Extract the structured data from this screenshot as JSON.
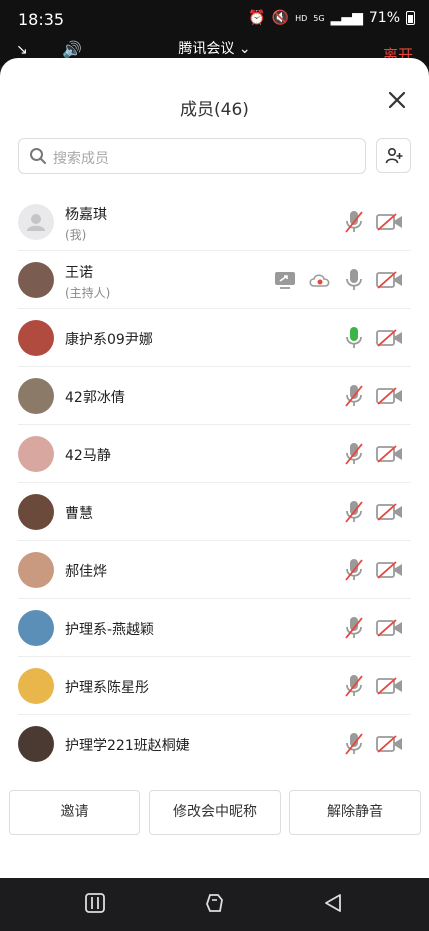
{
  "status_bar": {
    "time": "18:35",
    "net_hd": "HD",
    "net_5g": "5G",
    "battery": "71%"
  },
  "meeting_bar": {
    "title": "腾讯会议",
    "leave": "离开"
  },
  "panel": {
    "title": "成员(46)",
    "search_placeholder": "搜索成员"
  },
  "members": [
    {
      "name": "杨嘉琪",
      "sub": "(我)",
      "mic": "muted",
      "cam": "off",
      "avatar": "default"
    },
    {
      "name": "王诺",
      "sub": "(主持人)",
      "mic": "on-gray",
      "cam": "off",
      "sharing": true,
      "recording": true,
      "avatar_color": "#7a5d50"
    },
    {
      "name": "康护系09尹娜",
      "mic": "active",
      "cam": "off",
      "avatar_color": "#b24b3f"
    },
    {
      "name": "42郭冰倩",
      "mic": "muted",
      "cam": "off",
      "avatar_color": "#8c7a68"
    },
    {
      "name": "42马静",
      "mic": "muted",
      "cam": "off",
      "avatar_color": "#d8a7a0"
    },
    {
      "name": "曹慧",
      "mic": "muted",
      "cam": "off",
      "avatar_color": "#6b4a3c"
    },
    {
      "name": "郝佳烨",
      "mic": "muted",
      "cam": "off",
      "avatar_color": "#c99a7f"
    },
    {
      "name": "护理系-燕越颖",
      "mic": "muted",
      "cam": "off",
      "avatar_color": "#5b8fb8"
    },
    {
      "name": "护理系陈星彤",
      "mic": "muted",
      "cam": "off",
      "avatar_color": "#e8b64a"
    },
    {
      "name": "护理学221班赵桐婕",
      "mic": "muted",
      "cam": "off",
      "avatar_color": "#4a3a32"
    }
  ],
  "actions": {
    "invite": "邀请",
    "rename": "修改会中昵称",
    "unmute": "解除静音"
  },
  "colors": {
    "leave": "#e8453c",
    "mic_muted_slash": "#e8453c",
    "mic_active": "#3db44a",
    "icon_gray": "#9a9a9a"
  }
}
